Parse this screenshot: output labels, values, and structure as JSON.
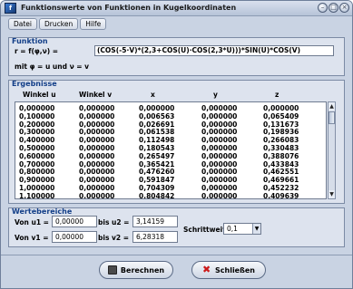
{
  "window": {
    "title": "Funktionswerte von Funktionen in Kugelkoordinaten",
    "app_icon": "app-icon",
    "controls": [
      "minimize",
      "maximize",
      "close"
    ]
  },
  "menu": {
    "items": [
      {
        "label": "Datei"
      },
      {
        "label": "Drucken"
      },
      {
        "label": "Hilfe"
      }
    ]
  },
  "funktion": {
    "group_title": "Funktion",
    "prefix": "r = f(φ,ν) =",
    "formula": "(COS(-5·V)*(2,3+COS(U)·COS(2,3*U)))*SIN(U)*COS(V)",
    "note": "mit  φ = u  und  ν = v"
  },
  "ergebnisse": {
    "group_title": "Ergebnisse",
    "columns": [
      "Winkel u",
      "Winkel v",
      "x",
      "y",
      "z"
    ],
    "rows": [
      [
        "0,000000",
        "0,000000",
        "0,000000",
        "0,000000",
        "0,000000"
      ],
      [
        "0,100000",
        "0,000000",
        "0,006563",
        "0,000000",
        "0,065409"
      ],
      [
        "0,200000",
        "0,000000",
        "0,026691",
        "0,000000",
        "0,131673"
      ],
      [
        "0,300000",
        "0,000000",
        "0,061538",
        "0,000000",
        "0,198936"
      ],
      [
        "0,400000",
        "0,000000",
        "0,112498",
        "0,000000",
        "0,266083"
      ],
      [
        "0,500000",
        "0,000000",
        "0,180543",
        "0,000000",
        "0,330483"
      ],
      [
        "0,600000",
        "0,000000",
        "0,265497",
        "0,000000",
        "0,388076"
      ],
      [
        "0,700000",
        "0,000000",
        "0,365421",
        "0,000000",
        "0,433843"
      ],
      [
        "0,800000",
        "0,000000",
        "0,476260",
        "0,000000",
        "0,462551"
      ],
      [
        "0,900000",
        "0,000000",
        "0,591847",
        "0,000000",
        "0,469661"
      ],
      [
        "1,000000",
        "0,000000",
        "0,704309",
        "0,000000",
        "0,452232"
      ],
      [
        "1,100000",
        "0,000000",
        "0,804842",
        "0,000000",
        "0,409639"
      ]
    ]
  },
  "wertebereiche": {
    "group_title": "Wertebereiche",
    "von_u1_label": "Von u1 =",
    "von_u1": "0,00000",
    "bis_u2_label": "bis  u2 =",
    "bis_u2": "3,14159",
    "von_v1_label": "Von v1 =",
    "von_v1": "0,00000",
    "bis_v2_label": "bis  v2 =",
    "bis_v2": "6,28318",
    "schrittweite_label": "Schrittweite:",
    "schrittweite": "0,1"
  },
  "buttons": {
    "berechnen": "Berechnen",
    "schliessen": "Schließen"
  },
  "colors": {
    "group_title": "#123e88",
    "window_bg": "#c9d3e3",
    "close_icon": "#cc1a1a"
  }
}
